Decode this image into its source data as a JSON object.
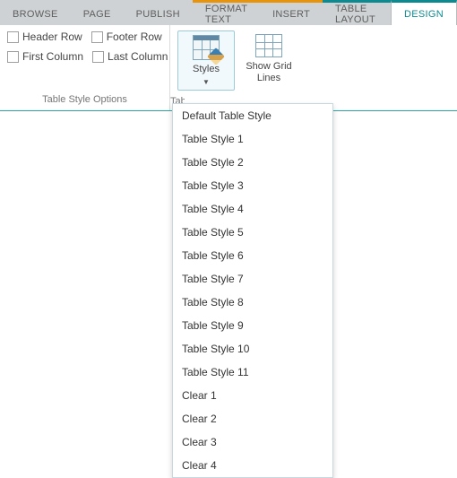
{
  "tabs": {
    "browse": "BROWSE",
    "page": "PAGE",
    "publish": "PUBLISH",
    "format_text": "FORMAT TEXT",
    "insert": "INSERT",
    "table_layout": "TABLE LAYOUT",
    "design": "DESIGN"
  },
  "options": {
    "header_row": "Header Row",
    "footer_row": "Footer Row",
    "first_column": "First Column",
    "last_column": "Last Column",
    "group_label": "Table Style Options"
  },
  "buttons": {
    "styles": "Styles",
    "show_grid_lines_l1": "Show Grid",
    "show_grid_lines_l2": "Lines"
  },
  "cut_label": "Table Styles",
  "styles_menu": [
    "Default Table Style",
    "Table Style 1",
    "Table Style 2",
    "Table Style 3",
    "Table Style 4",
    "Table Style 5",
    "Table Style 6",
    "Table Style 7",
    "Table Style 8",
    "Table Style 9",
    "Table Style 10",
    "Table Style 11",
    "Clear 1",
    "Clear 2",
    "Clear 3",
    "Clear 4"
  ]
}
